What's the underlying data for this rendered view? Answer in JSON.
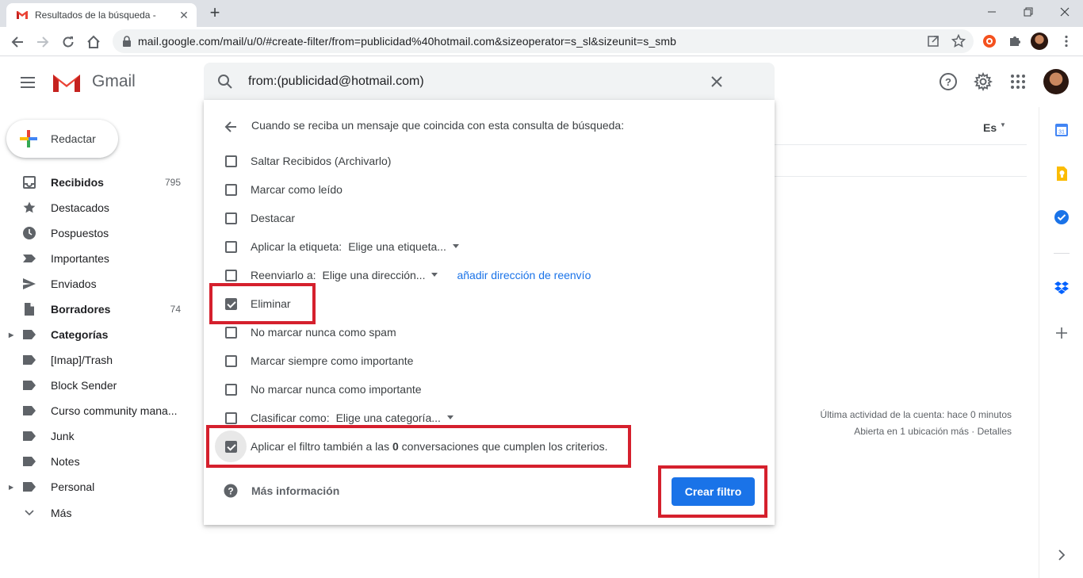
{
  "browser": {
    "tab_title": "Resultados de la búsqueda -",
    "url": "mail.google.com/mail/u/0/#create-filter/from=publicidad%40hotmail.com&sizeoperator=s_sl&sizeunit=s_smb"
  },
  "header": {
    "app_name": "Gmail",
    "search_query": "from:(publicidad@hotmail.com)"
  },
  "sidebar": {
    "compose_label": "Redactar",
    "items": [
      {
        "label": "Recibidos",
        "count": "795",
        "icon": "inbox-icon",
        "bold": true
      },
      {
        "label": "Destacados",
        "count": "",
        "icon": "star-icon"
      },
      {
        "label": "Pospuestos",
        "count": "",
        "icon": "clock-icon"
      },
      {
        "label": "Importantes",
        "count": "",
        "icon": "important-icon"
      },
      {
        "label": "Enviados",
        "count": "",
        "icon": "send-icon"
      },
      {
        "label": "Borradores",
        "count": "74",
        "icon": "draft-icon",
        "bold": true
      },
      {
        "label": "Categorías",
        "count": "",
        "icon": "label-icon",
        "bold": true
      },
      {
        "label": "[Imap]/Trash",
        "count": "",
        "icon": "label-icon"
      },
      {
        "label": "Block Sender",
        "count": "",
        "icon": "label-icon"
      },
      {
        "label": "Curso community mana...",
        "count": "",
        "icon": "label-icon"
      },
      {
        "label": "Junk",
        "count": "",
        "icon": "label-icon"
      },
      {
        "label": "Notes",
        "count": "",
        "icon": "label-icon"
      },
      {
        "label": "Personal",
        "count": "",
        "icon": "label-icon"
      },
      {
        "label": "Más",
        "count": "",
        "icon": "chevron-down-icon"
      }
    ]
  },
  "main": {
    "language": "Es",
    "activity_line1": "Última actividad de la cuenta: hace 0 minutos",
    "activity_line2": "Abierta en 1 ubicación más · Detalles"
  },
  "filter_dialog": {
    "heading": "Cuando se reciba un mensaje que coincida con esta consulta de búsqueda:",
    "options": [
      {
        "label": "Saltar Recibidos (Archivarlo)",
        "checked": false
      },
      {
        "label": "Marcar como leído",
        "checked": false
      },
      {
        "label": "Destacar",
        "checked": false
      },
      {
        "label": "Aplicar la etiqueta:",
        "dropdown": "Elige una etiqueta...",
        "checked": false
      },
      {
        "label": "Reenviarlo a:",
        "dropdown": "Elige una dirección...",
        "link": "añadir dirección de reenvío",
        "checked": false
      },
      {
        "label": "Eliminar",
        "checked": true
      },
      {
        "label": "No marcar nunca como spam",
        "checked": false
      },
      {
        "label": "Marcar siempre como importante",
        "checked": false
      },
      {
        "label": "No marcar nunca como importante",
        "checked": false
      },
      {
        "label": "Clasificar como:",
        "dropdown": "Elige una categoría...",
        "checked": false
      }
    ],
    "apply_also": {
      "prefix": "Aplicar el filtro también a las",
      "count": "0",
      "suffix": "conversaciones que cumplen los criterios.",
      "checked": true
    },
    "more_info": "Más información",
    "create_button": "Crear filtro"
  },
  "colors": {
    "accent_blue": "#1a73e8",
    "highlight_red": "#d5202d",
    "gmail_red": "#ea4335"
  }
}
